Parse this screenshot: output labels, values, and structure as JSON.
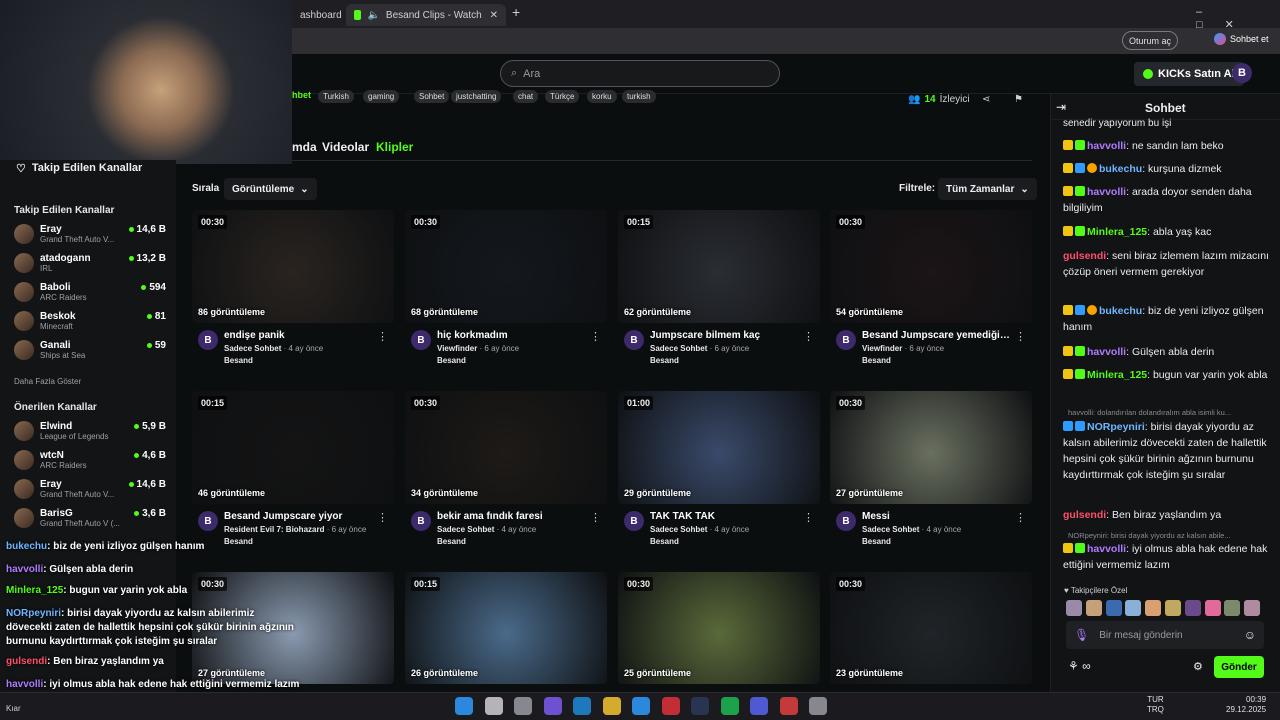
{
  "browser": {
    "tab1_label": "ashboard",
    "tab2_label": "Besand Clips - Watch Live on",
    "profile_label": "Oturum aç",
    "copilot_label": "Sohbet et"
  },
  "header": {
    "search_placeholder": "Ara",
    "kicks_button": "KICKs Satın Al"
  },
  "channel": {
    "tags": [
      "Turkish",
      "gaming",
      "Sohbet",
      "justchatting",
      "chat",
      "Türkçe",
      "korku",
      "turkish"
    ],
    "viewers_count": "14",
    "viewers_label": "İzleyici",
    "tabs": [
      "mda",
      "Videolar",
      "Klipler"
    ],
    "active_tab": "Klipler"
  },
  "sort": {
    "label": "Sırala",
    "value": "Görüntüleme"
  },
  "filter": {
    "label": "Filtrele:",
    "value": "Tüm Zamanlar"
  },
  "clips": [
    {
      "duration": "00:30",
      "views": "86 görüntüleme",
      "title": "endişe panik",
      "category": "Sadece Sohbet",
      "age": "4 ay önce",
      "channel": "Besand"
    },
    {
      "duration": "00:30",
      "views": "68 görüntüleme",
      "title": "hiç korkmadım",
      "category": "Viewfinder",
      "age": "6 ay önce",
      "channel": "Besand"
    },
    {
      "duration": "00:15",
      "views": "62 görüntüleme",
      "title": "Jumpscare bilmem kaç",
      "category": "Sadece Sohbet",
      "age": "6 ay önce",
      "channel": "Besand"
    },
    {
      "duration": "00:30",
      "views": "54 görüntüleme",
      "title": "Besand Jumpscare yemediğin...",
      "category": "Viewfinder",
      "age": "6 ay önce",
      "channel": "Besand"
    },
    {
      "duration": "00:15",
      "views": "46 görüntüleme",
      "title": "Besand Jumpscare yiyor",
      "category": "Resident Evil 7: Biohazard",
      "age": "6 ay önce",
      "channel": "Besand"
    },
    {
      "duration": "00:30",
      "views": "34 görüntüleme",
      "title": "bekir ama fındık faresi",
      "category": "Sadece Sohbet",
      "age": "4 ay önce",
      "channel": "Besand"
    },
    {
      "duration": "01:00",
      "views": "29 görüntüleme",
      "title": "TAK TAK TAK",
      "category": "Sadece Sohbet",
      "age": "4 ay önce",
      "channel": "Besand"
    },
    {
      "duration": "00:30",
      "views": "27 görüntüleme",
      "title": "Messi",
      "category": "Sadece Sohbet",
      "age": "4 ay önce",
      "channel": "Besand"
    },
    {
      "duration": "00:30",
      "views": "27 görüntüleme"
    },
    {
      "duration": "00:15",
      "views": "26 görüntüleme"
    },
    {
      "duration": "00:30",
      "views": "25 görüntüleme"
    },
    {
      "duration": "00:30",
      "views": "23 görüntüleme"
    }
  ],
  "sidebar": {
    "followed_title": "Takip Edilen Kanallar",
    "followed_heading": "Takip Edilen Kanallar",
    "followed": [
      {
        "name": "Eray",
        "game": "Grand Theft Auto V...",
        "viewers": "14,6 B"
      },
      {
        "name": "atadogann",
        "game": "IRL",
        "viewers": "13,2 B"
      },
      {
        "name": "Baboli",
        "game": "ARC Raiders",
        "viewers": "594"
      },
      {
        "name": "Beskok",
        "game": "Minecraft",
        "viewers": "81"
      },
      {
        "name": "Ganali",
        "game": "Ships at Sea",
        "viewers": "59"
      }
    ],
    "show_more": "Daha Fazla Göster",
    "recommended_heading": "Önerilen Kanallar",
    "recommended": [
      {
        "name": "Elwind",
        "game": "League of Legends",
        "viewers": "5,9 B"
      },
      {
        "name": "wtcN",
        "game": "ARC Raiders",
        "viewers": "4,6 B"
      },
      {
        "name": "Eray",
        "game": "Grand Theft Auto V...",
        "viewers": "14,6 B"
      },
      {
        "name": "BarisG",
        "game": "Grand Theft Auto V (...",
        "viewers": "3,6 B"
      }
    ]
  },
  "chat": {
    "title": "Sohbet",
    "top_partial": "senedir yapıyorum bu işi",
    "messages": [
      {
        "user": "havvolli",
        "color": "#b07cff",
        "text": "ne sandın lam beko"
      },
      {
        "user": "bukechu",
        "color": "#6fb6ff",
        "text": "kurşuna dizmek"
      },
      {
        "user": "havvolli",
        "color": "#b07cff",
        "text": "arada doyor senden daha bilgiliyim"
      },
      {
        "user": "Minlera_125",
        "color": "#53fc18",
        "text": "abla yaş kac"
      },
      {
        "user": "gulsendi",
        "color": "#ff4f6a",
        "text": "seni biraz izlemem lazım mizacını çözüp öneri vermem gerekiyor"
      },
      {
        "user": "bukechu",
        "color": "#6fb6ff",
        "text": "biz de yeni izliyoz gülşen hanım"
      },
      {
        "user": "havvolli",
        "color": "#b07cff",
        "text": "Gülşen abla derin"
      },
      {
        "user": "Minlera_125",
        "color": "#53fc18",
        "text": "bugun var yarin yok abla"
      },
      {
        "user": "NORpeyniri",
        "color": "#6fb6ff",
        "text": "birisi dayak yiyordu az kalsın abilerimiz dövecekti zaten de hallettik hepsini çok şükür birinin ağzının burnunu kaydırttırmak çok isteğim şu sıralar"
      },
      {
        "user": "gulsendi",
        "color": "#ff4f6a",
        "text": "Ben biraz yaşlandım ya"
      },
      {
        "user": "havvolli",
        "color": "#b07cff",
        "text": "iyi olmus abla hak edene hak ettiğini vermemiz lazım"
      }
    ],
    "reply1": "havvolli: dolandırılan dolandıralım abla isimli ku...",
    "reply2": "NORpeyniri: birisi dayak yiyordu az kalsın abile...",
    "emote_label": "Takipçilere Özel",
    "input_placeholder": "Bir mesaj gönderin",
    "send_label": "Gönder"
  },
  "overlay": {
    "lines": [
      {
        "user": "bukechu",
        "text": "biz de yeni izliyoz gülşen hanım"
      },
      {
        "user": "havvolli",
        "text": "Gülşen abla derin"
      },
      {
        "user": "Minlera_125",
        "text": "bugun var yarin yok abla"
      },
      {
        "user": "NORpeyniri",
        "text": "birisi dayak yiyordu az kalsın abilerimiz dövecekti zaten de hallettik hepsini çok şükür birinin ağzının burnunu kaydırttırmak çok isteğim şu sıralar"
      },
      {
        "user": "gulsendi",
        "text": "Ben biraz yaşlandım ya"
      },
      {
        "user": "havvolli",
        "text": "iyi olmus abla hak edene hak ettiğini vermemiz lazım"
      }
    ]
  },
  "taskbar": {
    "lang": "TUR",
    "lang2": "TRQ",
    "time": "00:39",
    "date": "29.12.2025",
    "weather": "Kıar"
  }
}
